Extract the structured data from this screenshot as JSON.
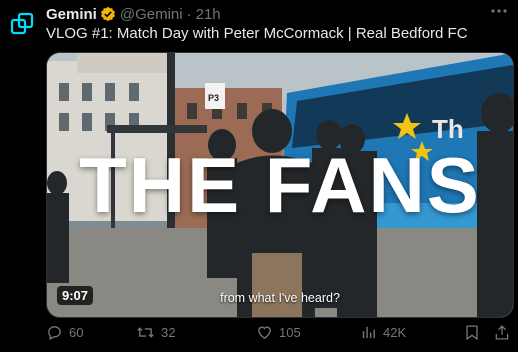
{
  "account": {
    "name": "Gemini",
    "handle": "@Gemini",
    "separator": "·",
    "time": "21h",
    "verified_color": "#f4b400"
  },
  "tweet": {
    "text": "VLOG #1: Match Day with Peter McCormack | Real Bedford FC"
  },
  "video": {
    "title_overlay": "THE FANS",
    "duration": "9:07",
    "caption": "from what I've heard?",
    "sign_text": "P3"
  },
  "actions": {
    "replies": "60",
    "retweets": "32",
    "likes": "105",
    "views": "42K"
  },
  "colors": {
    "brand": "#00dcfa",
    "muted": "#71767b",
    "text": "#e7e9ea",
    "background": "#000000"
  },
  "icons": [
    "gemini-logo-icon",
    "verified-badge-icon",
    "more-icon",
    "reply-icon",
    "retweet-icon",
    "like-icon",
    "views-icon",
    "bookmark-icon",
    "share-icon"
  ]
}
